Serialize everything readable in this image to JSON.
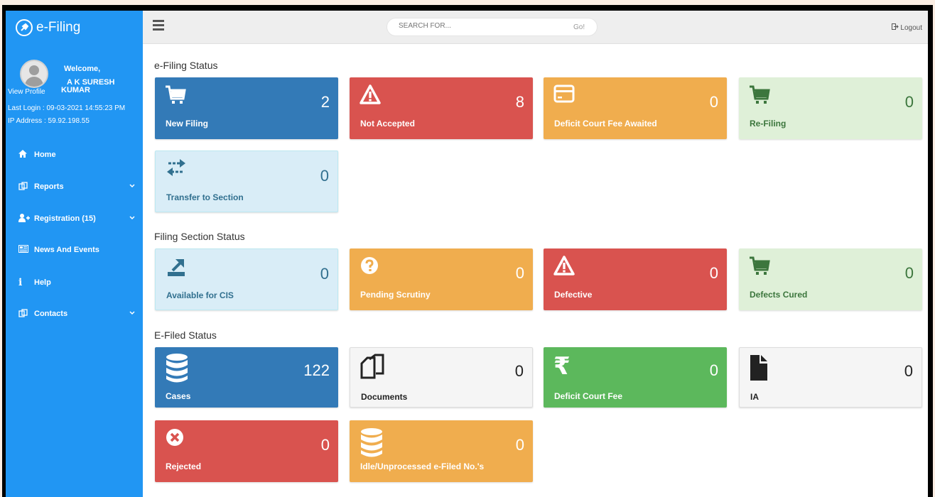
{
  "brand": {
    "title": "e-Filing"
  },
  "user": {
    "welcome": "Welcome,",
    "name": "A K SURESH KUMAR",
    "view_profile": "View Profile",
    "last_login": "Last Login : 09-03-2021 14:55:23 PM",
    "ip_address": "IP Address : 59.92.198.55"
  },
  "nav": {
    "home": "Home",
    "reports": "Reports",
    "registration": "Registration (15)",
    "news": "News And Events",
    "help": "Help",
    "contacts": "Contacts"
  },
  "topbar": {
    "search_placeholder": "SEARCH FOR...",
    "go": "Go!",
    "logout": "Logout"
  },
  "sections": {
    "efiling": "e-Filing Status",
    "filing_section": "Filing Section Status",
    "efiled": "E-Filed Status"
  },
  "tiles": {
    "new_filing": {
      "label": "New Filing",
      "count": "2"
    },
    "not_accepted": {
      "label": "Not Accepted",
      "count": "8"
    },
    "deficit_awaited": {
      "label": "Deficit Court Fee Awaited",
      "count": "0"
    },
    "refiling": {
      "label": "Re-Filing",
      "count": "0"
    },
    "transfer": {
      "label": "Transfer to Section",
      "count": "0"
    },
    "available_cis": {
      "label": "Available for CIS",
      "count": "0"
    },
    "pending_scrutiny": {
      "label": "Pending Scrutiny",
      "count": "0"
    },
    "defective": {
      "label": "Defective",
      "count": "0"
    },
    "defects_cured": {
      "label": "Defects Cured",
      "count": "0"
    },
    "cases": {
      "label": "Cases",
      "count": "122"
    },
    "documents": {
      "label": "Documents",
      "count": "0"
    },
    "deficit_fee": {
      "label": "Deficit Court Fee",
      "count": "0"
    },
    "ia": {
      "label": "IA",
      "count": "0"
    },
    "rejected": {
      "label": "Rejected",
      "count": "0"
    },
    "idle": {
      "label": "Idle/Unprocessed e-Filed No.'s",
      "count": "0"
    }
  },
  "colors": {
    "sidebar": "#2196f3",
    "primary": "#337ab7",
    "danger": "#d9534f",
    "warning": "#f0ad4e",
    "success": "#5cb85c",
    "success_light": "#dff0d8",
    "info_light": "#d9edf7"
  }
}
